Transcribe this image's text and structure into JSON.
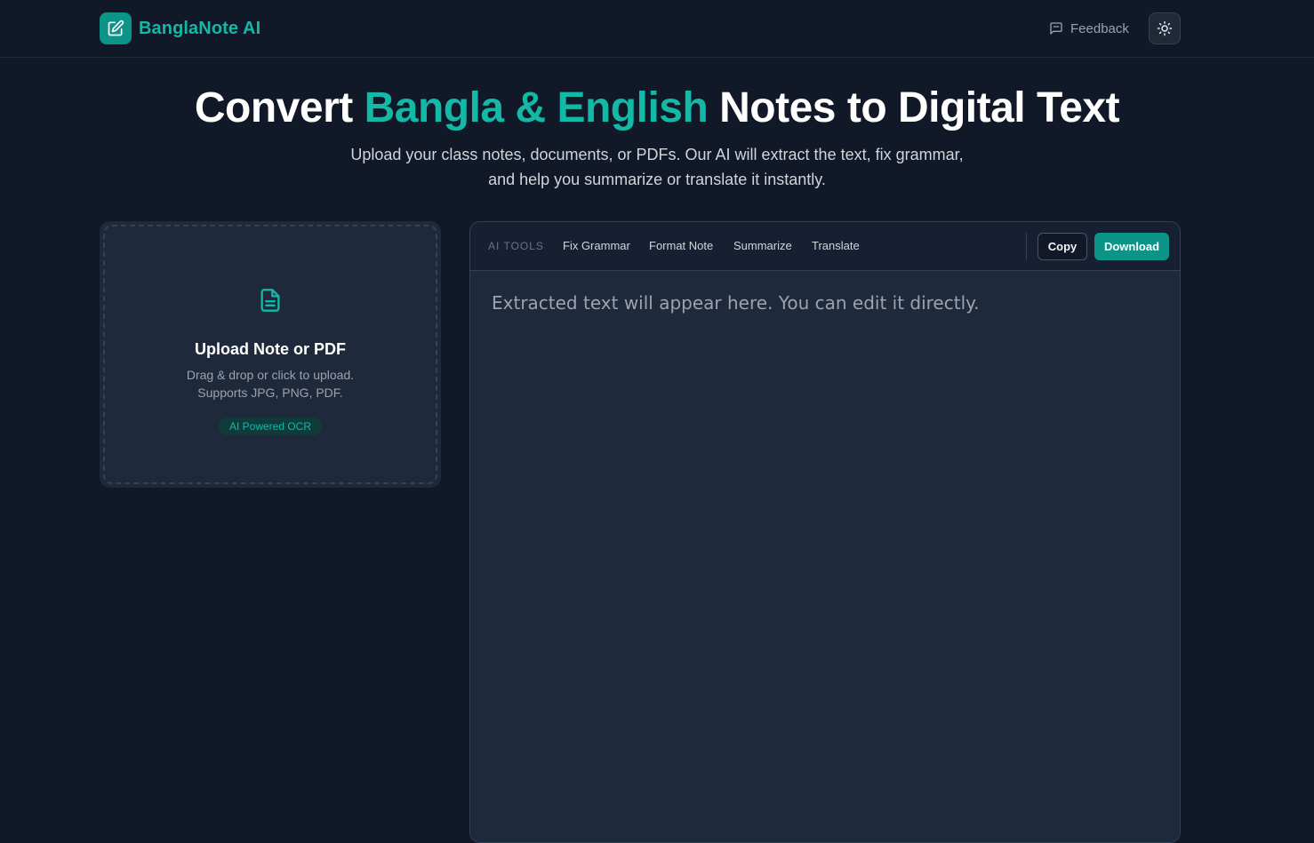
{
  "header": {
    "brand": "BanglaNote AI",
    "feedback_label": "Feedback",
    "logo_icon": "edit-note-icon",
    "theme_icon": "sun-icon"
  },
  "hero": {
    "title_part1": "Convert ",
    "title_accent": "Bangla & English",
    "title_part2": " Notes to Digital Text",
    "subtitle": "Upload your class notes, documents, or PDFs. Our AI will extract the text, fix grammar, and help you summarize or translate it instantly."
  },
  "upload": {
    "icon": "document-icon",
    "title": "Upload Note or PDF",
    "desc_line1": "Drag & drop or click to upload.",
    "desc_line2": "Supports JPG, PNG, PDF.",
    "badge": "AI Powered OCR"
  },
  "editor": {
    "tools_label": "AI TOOLS",
    "tools": [
      "Fix Grammar",
      "Format Note",
      "Summarize",
      "Translate"
    ],
    "copy_label": "Copy",
    "download_label": "Download",
    "placeholder": "Extracted text will appear here. You can edit it directly.",
    "value": ""
  },
  "colors": {
    "background": "#111827",
    "accent": "#14b8a6",
    "accent_dark": "#0d9488",
    "card": "#1e293b"
  }
}
